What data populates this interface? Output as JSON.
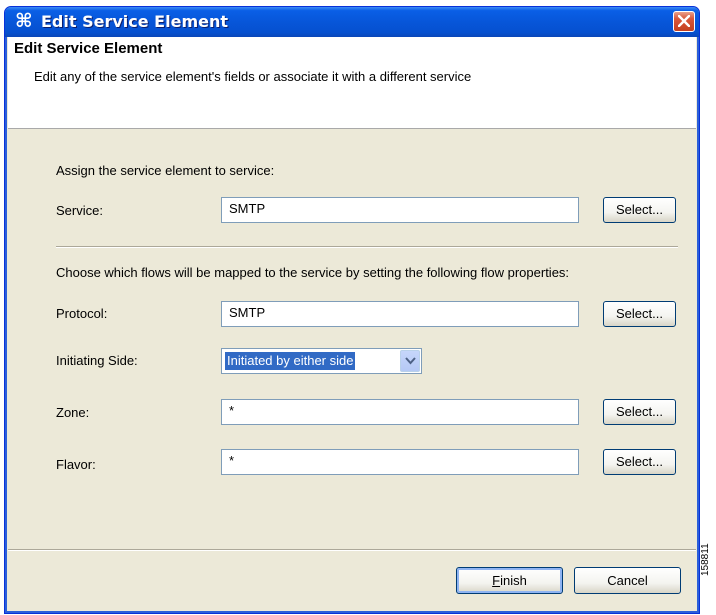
{
  "window": {
    "title": "Edit Service Element",
    "title_icon": "cisco-service-icon",
    "close_icon": "close-icon"
  },
  "header": {
    "title": "Edit Service Element",
    "description": "Edit any of the service element's fields or associate it with a different service"
  },
  "form": {
    "assign_label": "Assign the service element to service:",
    "service": {
      "label": "Service:",
      "value": "SMTP",
      "button": "Select..."
    },
    "flows_label": "Choose which flows will be mapped to the service by setting the following flow properties:",
    "protocol": {
      "label": "Protocol:",
      "value": "SMTP",
      "button": "Select..."
    },
    "initiating_side": {
      "label": "Initiating Side:",
      "selected": "Initiated by either side"
    },
    "zone": {
      "label": "Zone:",
      "value": "*",
      "button": "Select..."
    },
    "flavor": {
      "label": "Flavor:",
      "value": "*",
      "button": "Select..."
    }
  },
  "footer": {
    "finish_label": "Finish",
    "finish_mnemonic": "F",
    "finish_rest": "inish",
    "cancel_label": "Cancel"
  },
  "side_code": "158811"
}
